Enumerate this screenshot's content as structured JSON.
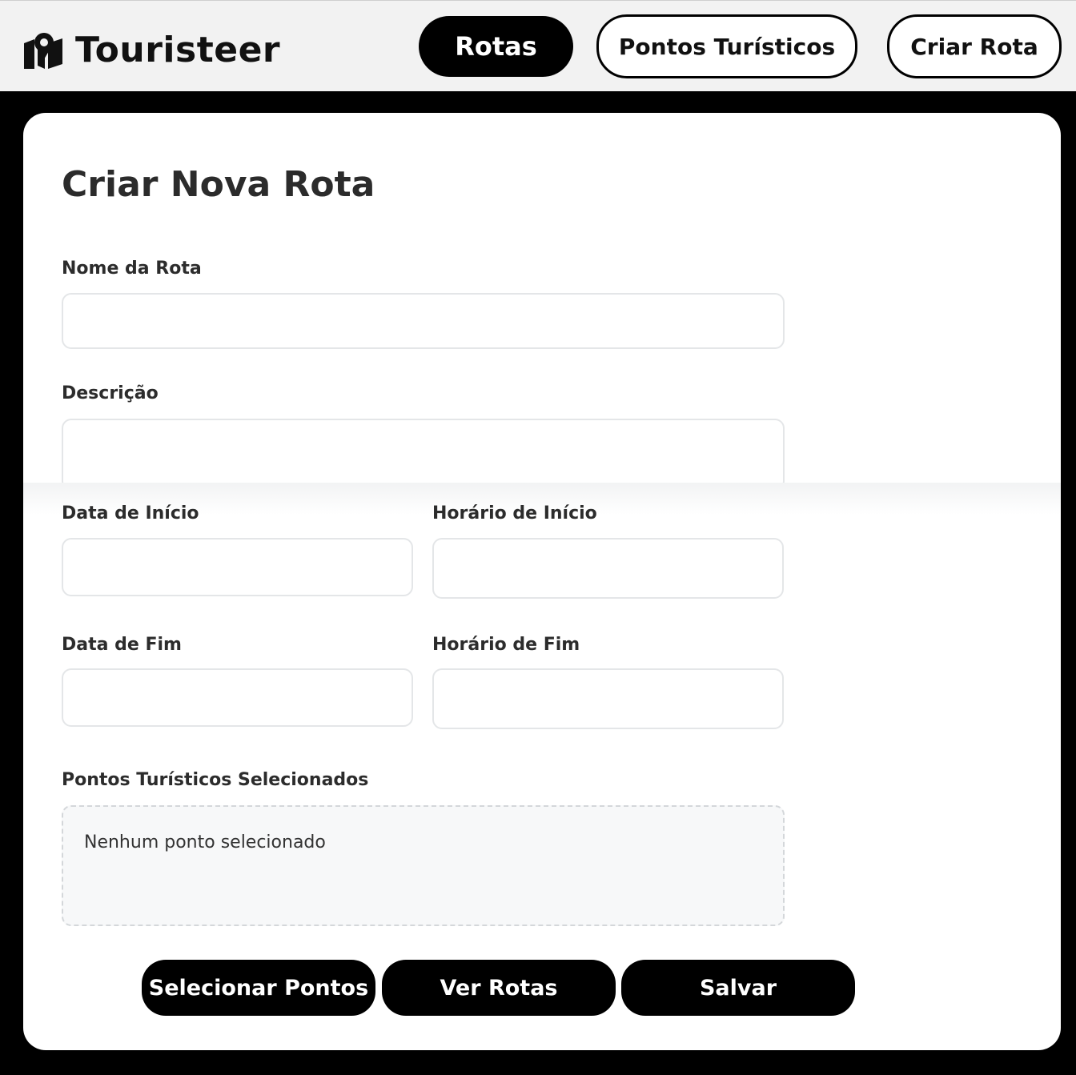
{
  "header": {
    "brand": "Touristeer",
    "logo_icon": "map-pin-icon",
    "nav": {
      "rotas": "Rotas",
      "pontos": "Pontos Turísticos",
      "criar": "Criar Rota"
    }
  },
  "form": {
    "title": "Criar Nova Rota",
    "fields": {
      "nome": {
        "label": "Nome da Rota",
        "value": ""
      },
      "descricao": {
        "label": "Descrição",
        "value": ""
      },
      "data_inicio": {
        "label": "Data de Início",
        "value": ""
      },
      "horario_inicio": {
        "label": "Horário de Início",
        "value": ""
      },
      "data_fim": {
        "label": "Data de Fim",
        "value": ""
      },
      "horario_fim": {
        "label": "Horário de Fim",
        "value": ""
      }
    },
    "points": {
      "label": "Pontos Turísticos Selecionados",
      "empty_text": "Nenhum ponto selecionado"
    },
    "buttons": {
      "selecionar": "Selecionar Pontos",
      "ver_rotas": "Ver Rotas",
      "salvar": "Salvar"
    }
  },
  "colors": {
    "header_bg": "#f2f2f2",
    "page_bg": "#000000",
    "card_bg": "#ffffff",
    "primary_button": "#000000",
    "input_border": "#e4e6e8",
    "points_box_bg": "#f7f8f9"
  }
}
